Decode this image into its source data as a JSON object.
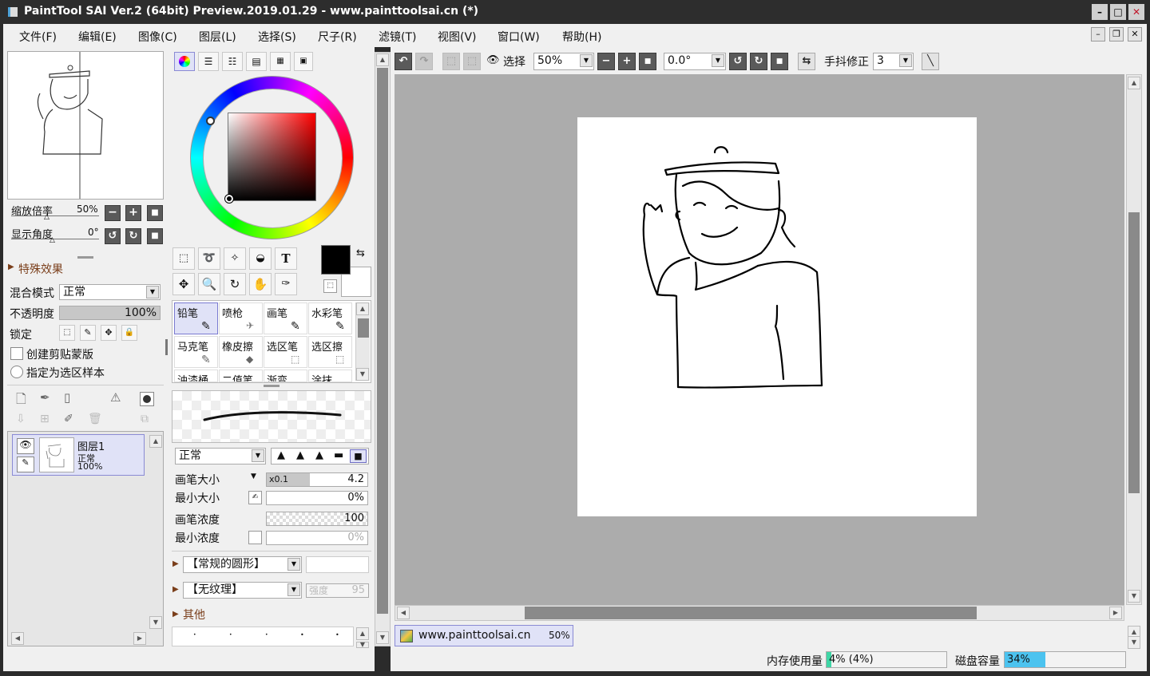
{
  "window": {
    "title": "PaintTool SAI Ver.2 (64bit) Preview.2019.01.29 - www.painttoolsai.cn (*)"
  },
  "menu": [
    "文件(F)",
    "编辑(E)",
    "图像(C)",
    "图层(L)",
    "选择(S)",
    "尺子(R)",
    "滤镜(T)",
    "视图(V)",
    "窗口(W)",
    "帮助(H)"
  ],
  "navigator": {
    "zoom_label": "缩放倍率",
    "zoom_value": "50%",
    "angle_label": "显示角度",
    "angle_value": "0°"
  },
  "layer_props": {
    "effects": "特殊效果",
    "blend_label": "混合模式",
    "blend_value": "正常",
    "opacity_label": "不透明度",
    "opacity_value": "100%",
    "lock_label": "锁定",
    "clip_label": "创建剪贴蒙版",
    "sample_label": "指定为选区样本"
  },
  "layer": {
    "name": "图层1",
    "mode": "正常",
    "opacity": "100%"
  },
  "brushes": [
    {
      "name": "铅笔",
      "selected": true
    },
    {
      "name": "喷枪"
    },
    {
      "name": "画笔"
    },
    {
      "name": "水彩笔"
    },
    {
      "name": "马克笔"
    },
    {
      "name": "橡皮擦"
    },
    {
      "name": "选区笔"
    },
    {
      "name": "选区擦"
    },
    {
      "name": "油漆桶"
    },
    {
      "name": "二值笔"
    },
    {
      "name": "渐变"
    },
    {
      "name": "涂抹"
    }
  ],
  "brush_settings": {
    "mode": "正常",
    "size_label": "画笔大小",
    "size_mult": "x0.1",
    "size_value": "4.2",
    "min_size_label": "最小大小",
    "min_size_value": "0%",
    "density_label": "画笔浓度",
    "density_value": "100",
    "min_density_label": "最小浓度",
    "min_density_value": "0%",
    "shape": "【常规的圆形】",
    "texture": "【无纹理】",
    "strength_label": "强度",
    "strength_value": "95",
    "other": "其他"
  },
  "toolbar": {
    "select_label": "选择",
    "zoom": "50%",
    "angle": "0.0°",
    "stabilizer_label": "手抖修正",
    "stabilizer_value": "3"
  },
  "canvas_tab": {
    "name": "www.painttoolsai.cn",
    "zoom": "50%"
  },
  "status": {
    "memory_label": "内存使用量",
    "memory_value": "4% (4%)",
    "memory_fraction": 0.04,
    "disk_label": "磁盘容量",
    "disk_value": "34%",
    "disk_fraction": 0.34
  },
  "colors": {
    "foreground": "#000000",
    "background": "#ffffff",
    "accent_select": "#e0e2f7",
    "disk_bar": "#4cc3ef",
    "memory_bar": "#3fd6a6"
  }
}
